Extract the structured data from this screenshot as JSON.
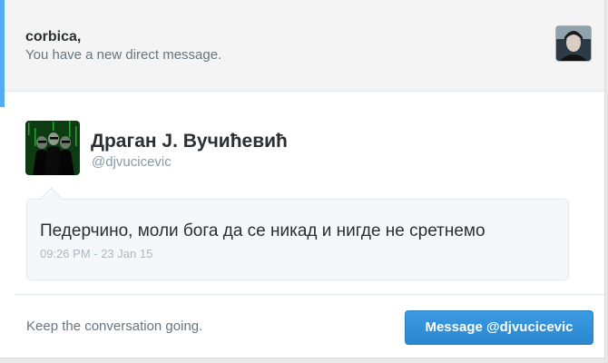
{
  "header": {
    "recipient": "corbica,",
    "notice": "You have a new direct message."
  },
  "sender": {
    "name": "Драган J. Вучићевић",
    "handle": "@djvucicevic"
  },
  "message": {
    "text": "Педерчино, моли бога да се никад и нигде не сретнемо",
    "timestamp": "09:26 PM - 23 Jan 15"
  },
  "footer": {
    "prompt": "Keep the conversation going.",
    "button_label": "Message @djvucicevic"
  },
  "colors": {
    "accent": "#55acee",
    "button": "#2b8ad3"
  }
}
